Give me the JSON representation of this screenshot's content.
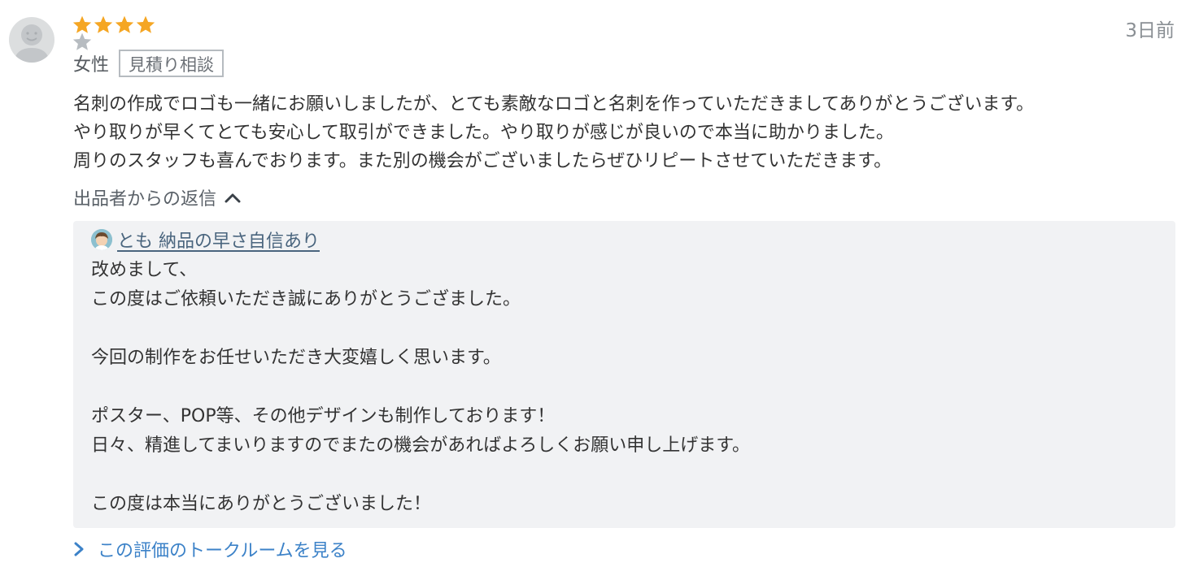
{
  "review": {
    "rating": 4,
    "max_rating": 5,
    "timestamp": "3日前",
    "gender": "女性",
    "tag": "見積り相談",
    "lines": [
      "名刺の作成でロゴも一緒にお願いしましたが、とても素敵なロゴと名刺を作っていただきましてありがとうございます。",
      "やり取りが早くてとても安心して取引ができました。やり取りが感じが良いので本当に助かりました。",
      "周りのスタッフも喜んでおります。また別の機会がございましたらぜひリピートさせていただきます。"
    ]
  },
  "reply": {
    "toggle_label": "出品者からの返信",
    "seller_name": "とも 納品の早さ自信あり",
    "lines": [
      "改めまして、",
      "この度はご依頼いただき誠にありがとうござました。",
      "",
      "今回の制作をお任せいただき大変嬉しく思います。",
      "",
      "ポスター、POP等、その他デザインも制作しております！",
      "日々、精進してまいりますのでまたの機会があればよろしくお願い申し上げます。",
      "",
      "この度は本当にありがとうございました！"
    ]
  },
  "talk_room_link": "この評価のトークルームを見る",
  "colors": {
    "star_filled": "#F5A623",
    "star_empty": "#B7BCC1",
    "link": "#3C82C8",
    "reply_bg": "#F1F2F4"
  },
  "icons": {
    "avatar": "default-user-avatar-icon",
    "star": "star-icon",
    "toggle": "chevron-up-icon",
    "link": "chevron-right-icon"
  }
}
